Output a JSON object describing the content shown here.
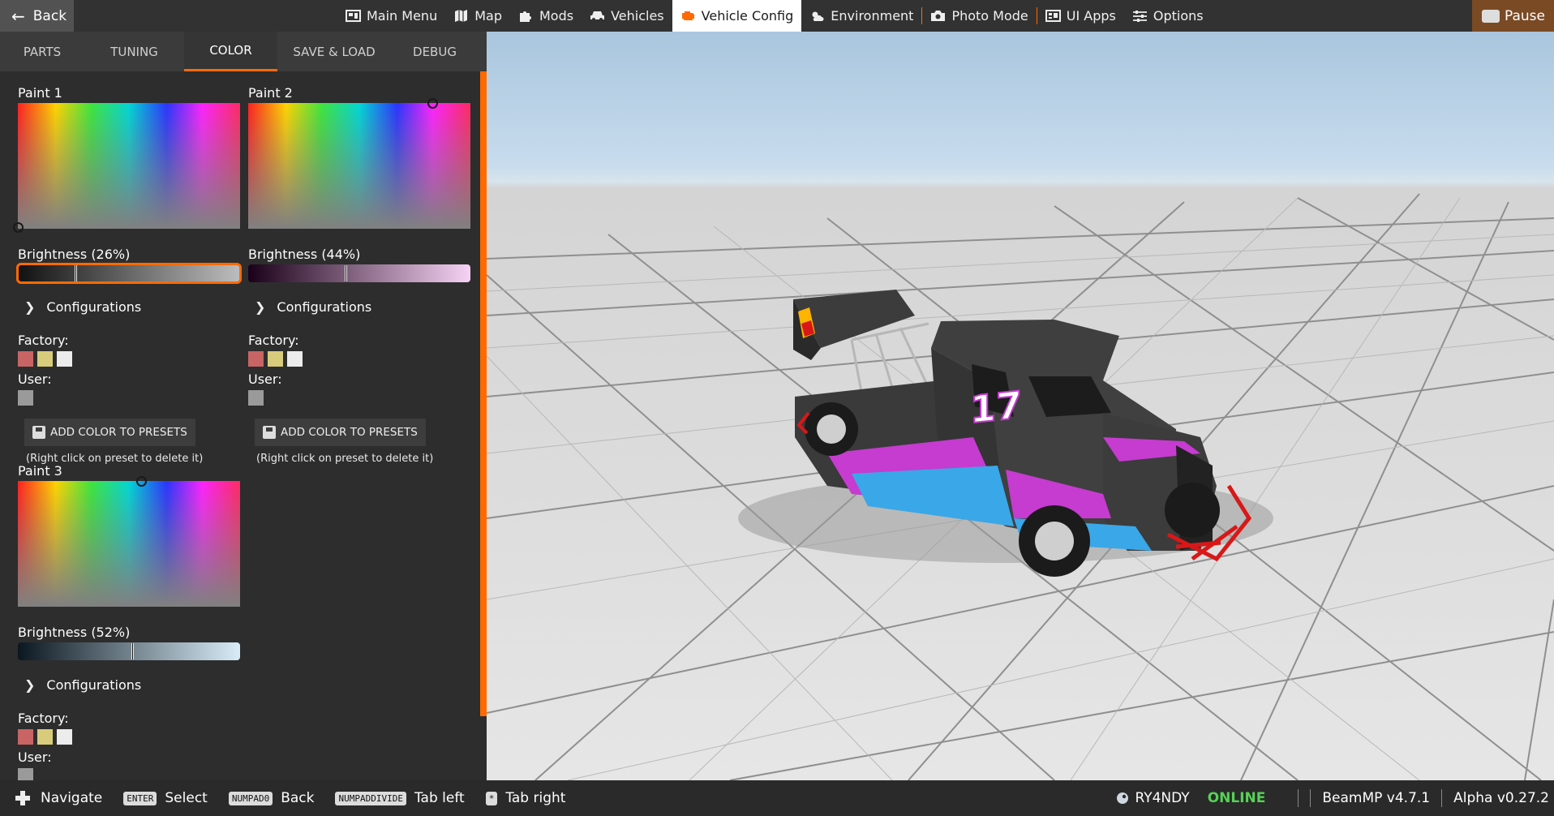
{
  "topbar": {
    "back_label": "Back",
    "menu": [
      {
        "label": "Main Menu",
        "icon": "main-menu-icon"
      },
      {
        "label": "Map",
        "icon": "map-icon"
      },
      {
        "label": "Mods",
        "icon": "puzzle-icon"
      },
      {
        "label": "Vehicles",
        "icon": "car-icon"
      },
      {
        "label": "Vehicle Config",
        "icon": "engine-icon",
        "active": true
      },
      {
        "label": "Environment",
        "icon": "weather-icon"
      },
      {
        "label": "Photo Mode",
        "icon": "camera-icon"
      },
      {
        "label": "UI Apps",
        "icon": "apps-icon"
      },
      {
        "label": "Options",
        "icon": "sliders-icon"
      }
    ],
    "pause_label": "Pause"
  },
  "tabs": [
    "PARTS",
    "TUNING",
    "COLOR",
    "SAVE & LOAD",
    "DEBUG"
  ],
  "active_tab": "COLOR",
  "paints": [
    {
      "title": "Paint 1",
      "brightness_label": "Brightness (26%)",
      "brightness": 0.26,
      "bright_colors": [
        "#111111",
        "#bdbdbd"
      ],
      "configs_label": "Configurations",
      "factory_label": "Factory:",
      "user_label": "User:",
      "factory_swatches": [
        "#c86464",
        "#d8cc7c",
        "#ececec"
      ],
      "user_swatches": [
        "#9a9a9a"
      ],
      "add_label": "ADD COLOR TO PRESETS",
      "hint": "(Right click on preset to delete it)"
    },
    {
      "title": "Paint 2",
      "brightness_label": "Brightness (44%)",
      "brightness": 0.44,
      "bright_colors": [
        "#1a0018",
        "#f6d2f4"
      ],
      "configs_label": "Configurations",
      "factory_label": "Factory:",
      "user_label": "User:",
      "factory_swatches": [
        "#c86464",
        "#d8cc7c",
        "#ececec"
      ],
      "user_swatches": [
        "#9a9a9a"
      ],
      "add_label": "ADD COLOR TO PRESETS",
      "hint": "(Right click on preset to delete it)"
    },
    {
      "title": "Paint 3",
      "brightness_label": "Brightness (52%)",
      "brightness": 0.52,
      "bright_colors": [
        "#0b1720",
        "#d8ecf8"
      ],
      "configs_label": "Configurations",
      "factory_label": "Factory:",
      "user_label": "User:",
      "factory_swatches": [
        "#c86464",
        "#d8cc7c",
        "#ececec"
      ],
      "user_swatches": [
        "#9a9a9a"
      ]
    }
  ],
  "vehicle": {
    "number": "17",
    "accent": "#ff6a00",
    "body": "#3a3a3a",
    "stripe_pink": "#c63bd0",
    "stripe_blue": "#3aa7e8",
    "bumper": "#d81818"
  },
  "bottombar": {
    "hints": [
      {
        "key": "",
        "label": "Navigate"
      },
      {
        "key": "ENTER",
        "label": "Select"
      },
      {
        "key": "NUMPAD0",
        "label": "Back"
      },
      {
        "key": "NUMPADDIVIDE",
        "label": "Tab left"
      },
      {
        "key": "*",
        "label": "Tab right"
      }
    ],
    "user": "RY4NDY",
    "online": "ONLINE",
    "beammp": "BeamMP v4.7.1",
    "version": "Alpha v0.27.2"
  }
}
